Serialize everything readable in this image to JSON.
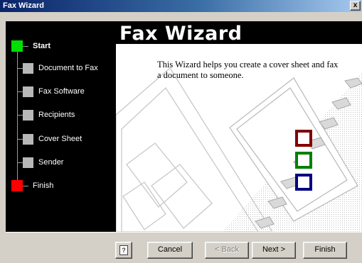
{
  "window": {
    "title": "Fax Wizard",
    "close_label": "x"
  },
  "banner": {
    "title": "Fax Wizard"
  },
  "intro": {
    "text": "This Wizard helps you create a cover sheet and fax a document to someone."
  },
  "steps": [
    {
      "label": "Start",
      "state": "current"
    },
    {
      "label": "Document to Fax",
      "state": "pending"
    },
    {
      "label": "Fax Software",
      "state": "pending"
    },
    {
      "label": "Recipients",
      "state": "pending"
    },
    {
      "label": "Cover Sheet",
      "state": "pending"
    },
    {
      "label": "Sender",
      "state": "pending"
    },
    {
      "label": "Finish",
      "state": "end"
    }
  ],
  "buttons": {
    "help_icon": "help-book-icon",
    "cancel": "Cancel",
    "back": "< Back",
    "next": "Next >",
    "finish": "Finish"
  },
  "colors": {
    "start_marker": "#00e000",
    "finish_marker": "#ff0000",
    "box_red": "#800000",
    "box_green": "#008000",
    "box_blue": "#000080"
  }
}
